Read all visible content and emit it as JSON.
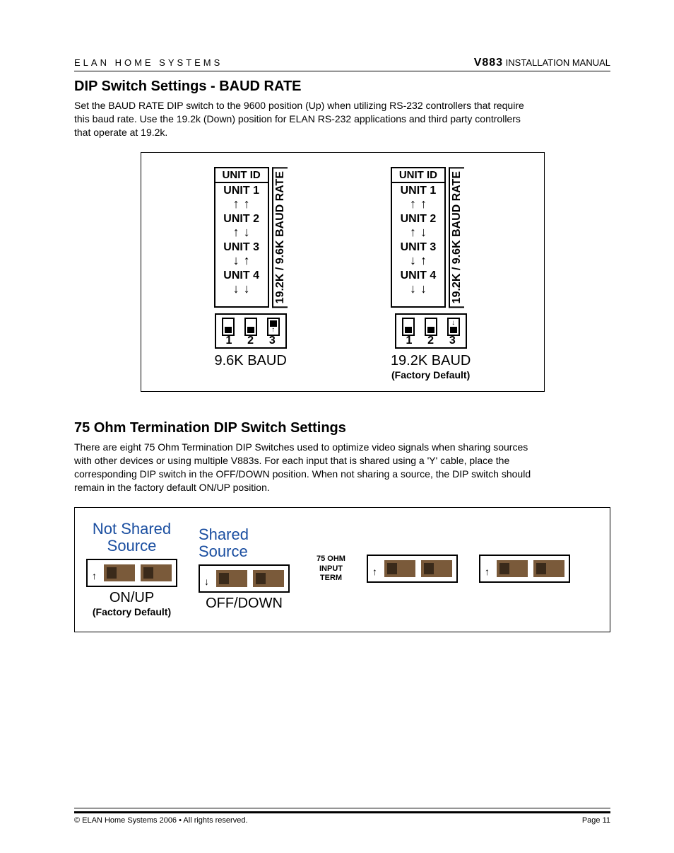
{
  "header": {
    "left": "ELAN HOME SYSTEMS",
    "right_bold": "V883",
    "right_rest": " INSTALLATION MANUAL"
  },
  "section1": {
    "title": "DIP Switch Settings - BAUD RATE",
    "body": "Set the BAUD RATE DIP switch to the 9600 position (Up) when utilizing RS-232 controllers that require this baud rate.  Use the 19.2k (Down) position for ELAN RS-232 applications and third party controllers that operate at 19.2k."
  },
  "dip": {
    "unit_head": "UNIT ID",
    "unit1": "UNIT 1",
    "unit2": "UNIT 2",
    "unit3": "UNIT 3",
    "unit4": "UNIT 4",
    "baud_side": "19.2K / 9.6K BAUD RATE",
    "nums": [
      "1",
      "2",
      "3"
    ],
    "left_caption": "9.6K BAUD",
    "right_caption": "19.2K BAUD",
    "right_sub": "(Factory Default)"
  },
  "section2": {
    "title": "75 Ohm Termination DIP Switch Settings",
    "body": "There are eight 75 Ohm Termination DIP Switches used to optimize video signals when sharing sources with other devices or using multiple V883s.  For each input that is shared using a 'Y' cable, place the corresponding DIP switch in the OFF/DOWN position.  When not sharing a source, the  DIP switch should remain in the factory default ON/UP position."
  },
  "term": {
    "not_shared_title1": "Not Shared",
    "not_shared_title2": "Source",
    "shared_title1": "Shared",
    "shared_title2": "Source",
    "label_line1": "75 OHM",
    "label_line2": "INPUT",
    "label_line3": "TERM",
    "on_up": "ON/UP",
    "off_down": "OFF/DOWN",
    "factory": "(Factory Default)"
  },
  "footer": {
    "left": "© ELAN Home Systems  2006 • All rights reserved.",
    "right": "Page 11"
  }
}
